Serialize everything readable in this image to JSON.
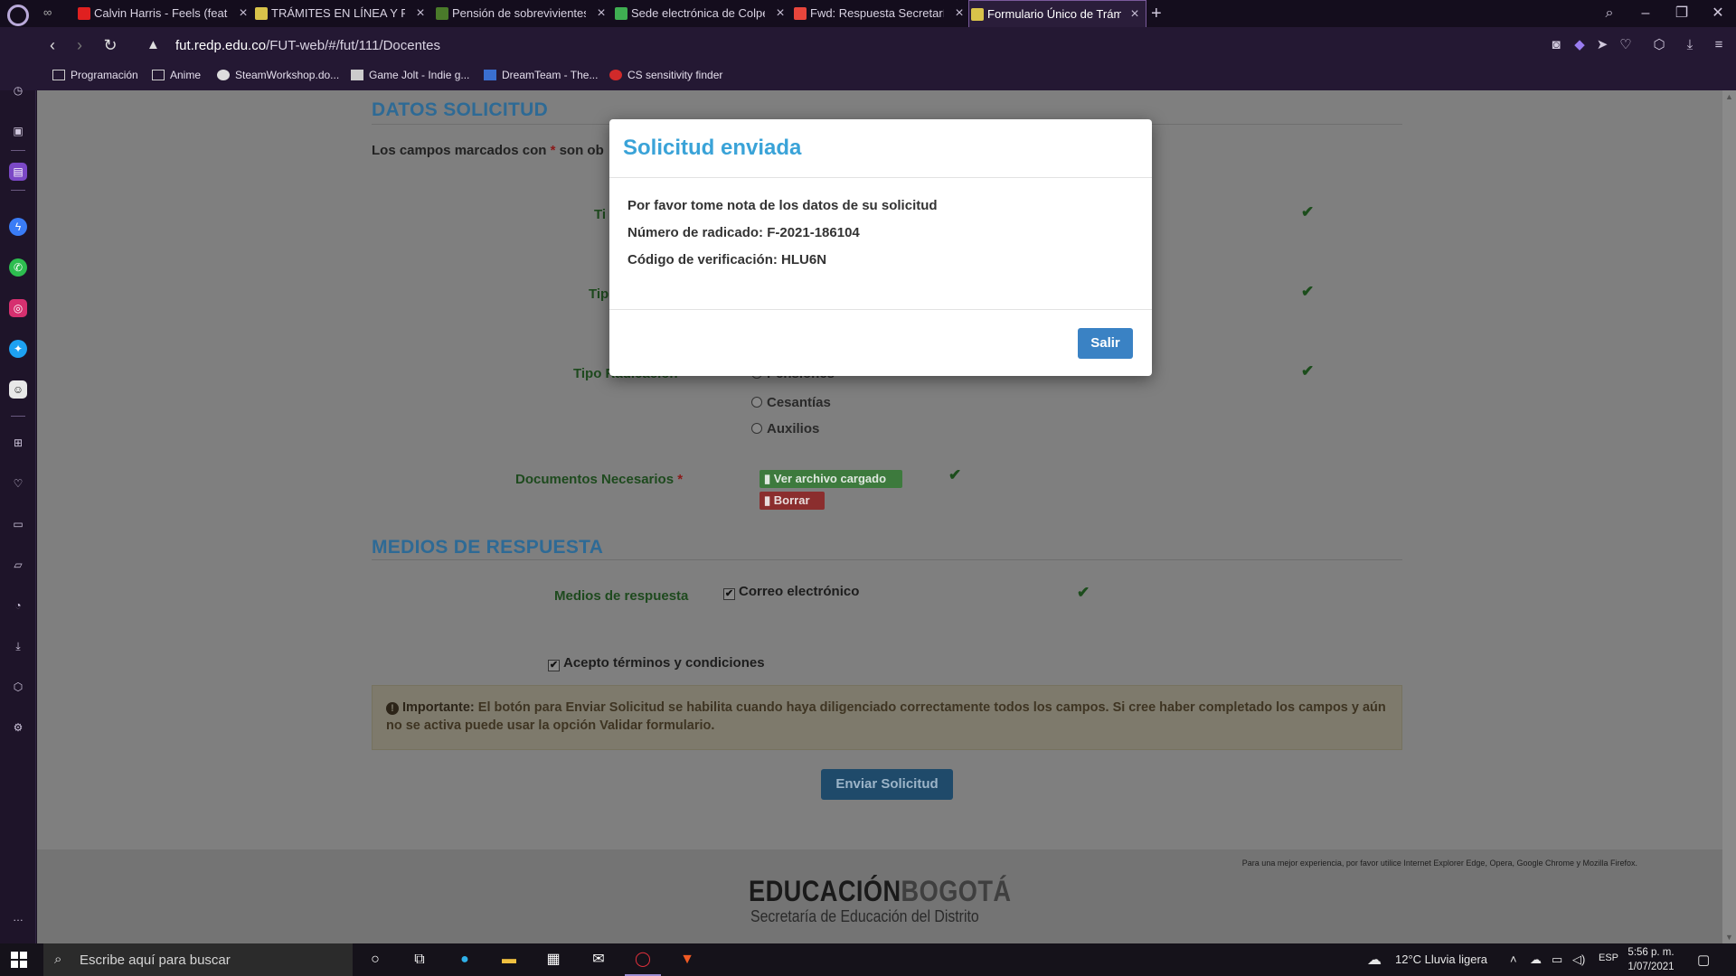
{
  "browser": {
    "tabs": [
      {
        "title": "Calvin Harris - Feels (feat. P",
        "favicon_color": "#e02020"
      },
      {
        "title": "TRÁMITES EN LÍNEA Y PRE",
        "favicon_color": "#d8c24a"
      },
      {
        "title": "Pensión de sobrevivientes",
        "favicon_color": "#4a7a2a"
      },
      {
        "title": "Sede electrónica de Colpe",
        "favicon_color": "#3fae52"
      },
      {
        "title": "Fwd: Respuesta Secretaría",
        "favicon_color": "#e8453c"
      },
      {
        "title": "Formulario Único de Trámit",
        "favicon_color": "#d8c24a"
      }
    ],
    "url_domain": "fut.redp.edu.co",
    "url_path": "/FUT-web/#/fut/111/Docentes",
    "bookmarks": [
      "Programación",
      "Anime",
      "SteamWorkshop.do...",
      "Game Jolt - Indie g...",
      "DreamTeam - The...",
      "CS sensitivity finder"
    ]
  },
  "page": {
    "section1_title": "DATOS SOLICITUD",
    "required_note_prefix": "Los campos marcados con",
    "required_star": "*",
    "required_note_suffix": "son ob",
    "field_tipo1": "Ti",
    "field_tipo2": "Tip",
    "field_tipo_radicacion": "Tipo Radicación",
    "radio_options": [
      "Pensiones",
      "Cesantías",
      "Auxilios"
    ],
    "docs_label": "Documentos Necesarios",
    "view_file_label": "Ver archivo cargado",
    "delete_label": "Borrar",
    "section2_title": "MEDIOS DE RESPUESTA",
    "medios_label": "Medios de respuesta",
    "email_option": "Correo electrónico",
    "terms_label": "Acepto términos y condiciones",
    "alert_strong": "Importante:",
    "alert_text": "El botón para Enviar Solicitud se habilita cuando haya diligenciado correctamente todos los campos. Si cree haber completado los campos y aún no se activa puede usar la opción Validar formulario.",
    "submit_label": "Enviar Solicitud",
    "footer_note": "Para una mejor experiencia, por favor utilice Internet Explorer Edge, Opera, Google Chrome y Mozilla Firefox.",
    "logo_part1": "EDUCACIÓN",
    "logo_part2": "BOGOTÁ",
    "logo_sub": "Secretaría de Educación del Distrito"
  },
  "modal": {
    "title": "Solicitud enviada",
    "line1": "Por favor tome nota de los datos de su solicitud",
    "line2": "Número de radicado: F-2021-186104",
    "line3": "Código de verificación: HLU6N",
    "exit_label": "Salir"
  },
  "taskbar": {
    "search_placeholder": "Escribe aquí para buscar",
    "weather": "12°C  Lluvia ligera",
    "lang": "ESP",
    "time": "5:56 p. m.",
    "date": "1/07/2021"
  },
  "colors": {
    "accent_title": "#3aa3d8",
    "button_blue": "#3a82c4",
    "browser_bg": "#241833"
  }
}
